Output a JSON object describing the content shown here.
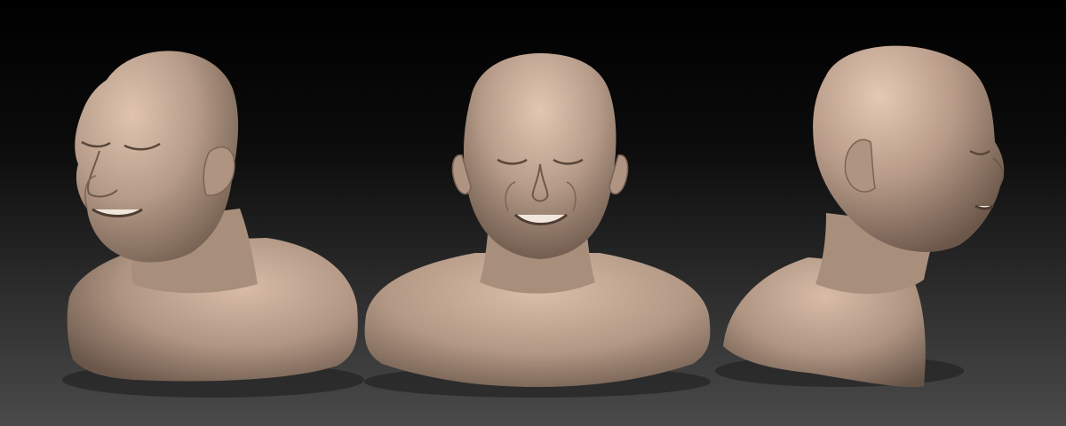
{
  "scene": {
    "background_top": "#000000",
    "background_bottom": "#4a4a4a",
    "skin_highlight": "#d9bca8",
    "skin_mid": "#a8907e",
    "skin_shadow": "#5a4a40",
    "floor_shadow": "#2a2a2a"
  },
  "views": [
    {
      "view": "three-quarter-left",
      "expression": "smiling-eyes-closed"
    },
    {
      "view": "front",
      "expression": "smiling-eyes-closed"
    },
    {
      "view": "profile-right",
      "expression": "smiling-eyes-closed"
    }
  ]
}
